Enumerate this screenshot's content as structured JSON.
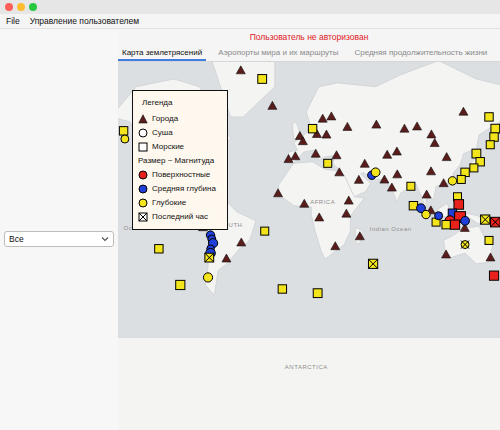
{
  "window": {
    "controls": [
      "close",
      "minimize",
      "zoom"
    ]
  },
  "menu": [
    {
      "label": "File"
    },
    {
      "label": "Управление пользователем"
    }
  ],
  "status": {
    "text": "Пользователь не авторизован",
    "color": "#e0201e"
  },
  "tabs": [
    {
      "label": "Карта землетрясений",
      "selected": true
    },
    {
      "label": "Аэропорты мира и их маршруты",
      "selected": false
    },
    {
      "label": "Средняя продолжительность жизни",
      "selected": false
    }
  ],
  "sidebar": {
    "filter": {
      "value": "Все"
    }
  },
  "legend": {
    "title": "Легенда",
    "items": [
      {
        "kind": "city",
        "label": "Города"
      },
      {
        "kind": "land",
        "label": "Суша"
      },
      {
        "kind": "sea",
        "label": "Морские"
      },
      {
        "kind": "note",
        "label": "Размер ~ Магнитуда"
      },
      {
        "kind": "shallow",
        "label": "Поверхностные",
        "color": "#e8211d"
      },
      {
        "kind": "mid",
        "label": "Средняя глубина",
        "color": "#1f3fd8"
      },
      {
        "kind": "deep",
        "label": "Глубокие",
        "color": "#f3e41c"
      },
      {
        "kind": "recent",
        "label": "Последний час"
      }
    ]
  },
  "map": {
    "labels": [
      {
        "text": "AFRICA",
        "lon": 18,
        "lat": 6
      },
      {
        "text": "SOUTH",
        "lon": -55,
        "lat": -12
      },
      {
        "text": "ANTARCTICA",
        "lon": 5,
        "lat": -77
      },
      {
        "text": "Indian Ocean",
        "lon": 72,
        "lat": -15
      },
      {
        "text": "Ocean",
        "lon": -140,
        "lat": -14
      }
    ],
    "cities": [
      {
        "lon": -47,
        "lat": 74
      },
      {
        "lon": -0.1,
        "lat": 51.5
      },
      {
        "lon": 2.3,
        "lat": 48.9
      },
      {
        "lon": 13.4,
        "lat": 52.5
      },
      {
        "lon": 37.6,
        "lat": 55.8
      },
      {
        "lon": -3.7,
        "lat": 40.4
      },
      {
        "lon": 12.5,
        "lat": 41.9
      },
      {
        "lon": 18,
        "lat": 59.3
      },
      {
        "lon": -21.9,
        "lat": 64.1
      },
      {
        "lon": 29,
        "lat": 41
      },
      {
        "lon": 24.9,
        "lat": 60.2
      },
      {
        "lon": 21,
        "lat": 52.2
      },
      {
        "lon": -9.1,
        "lat": 38.7
      },
      {
        "lon": 31.2,
        "lat": 30
      },
      {
        "lon": 51.4,
        "lat": 35.7
      },
      {
        "lon": 46.7,
        "lat": 24.7
      },
      {
        "lon": 77.2,
        "lat": 28.6
      },
      {
        "lon": 72.9,
        "lat": 19
      },
      {
        "lon": 67,
        "lat": 24.9
      },
      {
        "lon": 60.6,
        "lat": 56.8
      },
      {
        "lon": 82.9,
        "lat": 55
      },
      {
        "lon": 92.9,
        "lat": 56
      },
      {
        "lon": 129.7,
        "lat": 62
      },
      {
        "lon": 104.3,
        "lat": 52.3
      },
      {
        "lon": 76.9,
        "lat": 43.2
      },
      {
        "lon": 69.2,
        "lat": 41.3
      },
      {
        "lon": 116.4,
        "lat": 39.9
      },
      {
        "lon": 104,
        "lat": 30.7
      },
      {
        "lon": 114,
        "lat": 22.3
      },
      {
        "lon": 106.9,
        "lat": 47.9
      },
      {
        "lon": 100.5,
        "lat": 13.7
      },
      {
        "lon": 103.8,
        "lat": 1.3
      },
      {
        "lon": 3.4,
        "lat": 6.5
      },
      {
        "lon": 15.3,
        "lat": -4.3
      },
      {
        "lon": 36.8,
        "lat": -1.3
      },
      {
        "lon": 28,
        "lat": -26.2
      },
      {
        "lon": 38.7,
        "lat": 9
      },
      {
        "lon": -17.4,
        "lat": 14.7
      },
      {
        "lon": 115.9,
        "lat": -31.9
      },
      {
        "lon": 151.2,
        "lat": -33.9
      },
      {
        "lon": 130.8,
        "lat": -12.5
      },
      {
        "lon": -77,
        "lat": -12
      },
      {
        "lon": -58.4,
        "lat": -34.6
      },
      {
        "lon": -46.6,
        "lat": -23.5
      },
      {
        "lon": -74,
        "lat": 4.7
      },
      {
        "lon": 47.5,
        "lat": -18.9
      }
    ],
    "earthquakes": [
      {
        "lon": -140,
        "lat": 54,
        "kind": "sea",
        "depth": "deep",
        "magnitude": 4.6,
        "recent": false
      },
      {
        "lon": -139,
        "lat": 50,
        "kind": "land",
        "depth": "deep",
        "magnitude": 4.5,
        "recent": false
      },
      {
        "lon": -30,
        "lat": 72,
        "kind": "sea",
        "depth": "deep",
        "magnitude": 4.7,
        "recent": false
      },
      {
        "lon": -112,
        "lat": -28,
        "kind": "sea",
        "depth": "deep",
        "magnitude": 4.6,
        "recent": false
      },
      {
        "lon": -95,
        "lat": -50,
        "kind": "sea",
        "depth": "deep",
        "magnitude": 4.8,
        "recent": false
      },
      {
        "lon": -77,
        "lat": 1,
        "kind": "land",
        "depth": "mid",
        "magnitude": 4.5,
        "recent": false
      },
      {
        "lon": -71,
        "lat": -18,
        "kind": "land",
        "depth": "mid",
        "magnitude": 4.6,
        "recent": false
      },
      {
        "lon": -70,
        "lat": -21,
        "kind": "land",
        "depth": "mid",
        "magnitude": 4.5,
        "recent": false
      },
      {
        "lon": -69,
        "lat": -24,
        "kind": "land",
        "depth": "mid",
        "magnitude": 4.8,
        "recent": false
      },
      {
        "lon": -71,
        "lat": -28,
        "kind": "land",
        "depth": "mid",
        "magnitude": 4.4,
        "recent": false
      },
      {
        "lon": -71,
        "lat": -31,
        "kind": "land",
        "depth": "mid",
        "magnitude": 4.9,
        "recent": false
      },
      {
        "lon": -72,
        "lat": -34,
        "kind": "sea",
        "depth": "deep",
        "magnitude": 4.7,
        "recent": true
      },
      {
        "lon": -73,
        "lat": -46,
        "kind": "land",
        "depth": "deep",
        "magnitude": 4.8,
        "recent": false
      },
      {
        "lon": -28,
        "lat": -15,
        "kind": "sea",
        "depth": "deep",
        "magnitude": 4.5,
        "recent": false
      },
      {
        "lon": -14,
        "lat": -52,
        "kind": "sea",
        "depth": "deep",
        "magnitude": 4.6,
        "recent": false
      },
      {
        "lon": 14,
        "lat": -54,
        "kind": "sea",
        "depth": "deep",
        "magnitude": 4.7,
        "recent": false
      },
      {
        "lon": 10,
        "lat": 55,
        "kind": "sea",
        "depth": "deep",
        "magnitude": 4.6,
        "recent": false
      },
      {
        "lon": 22,
        "lat": 36,
        "kind": "sea",
        "depth": "deep",
        "magnitude": 4.5,
        "recent": false
      },
      {
        "lon": 57,
        "lat": 28,
        "kind": "land",
        "depth": "mid",
        "magnitude": 4.6,
        "recent": false
      },
      {
        "lon": 60,
        "lat": 30,
        "kind": "land",
        "depth": "deep",
        "magnitude": 4.7,
        "recent": false
      },
      {
        "lon": 58,
        "lat": -38,
        "kind": "sea",
        "depth": "deep",
        "magnitude": 4.8,
        "recent": true
      },
      {
        "lon": 88,
        "lat": 20,
        "kind": "sea",
        "depth": "deep",
        "magnitude": 4.5,
        "recent": false
      },
      {
        "lon": 90,
        "lat": 5,
        "kind": "sea",
        "depth": "deep",
        "magnitude": 4.6,
        "recent": false
      },
      {
        "lon": 96,
        "lat": 3,
        "kind": "land",
        "depth": "mid",
        "magnitude": 4.7,
        "recent": false
      },
      {
        "lon": 140,
        "lat": 42,
        "kind": "sea",
        "depth": "deep",
        "magnitude": 4.7,
        "recent": false
      },
      {
        "lon": 143,
        "lat": 37,
        "kind": "sea",
        "depth": "deep",
        "magnitude": 4.6,
        "recent": false
      },
      {
        "lon": 138,
        "lat": 33,
        "kind": "sea",
        "depth": "deep",
        "magnitude": 4.5,
        "recent": false
      },
      {
        "lon": 131,
        "lat": 30,
        "kind": "sea",
        "depth": "deep",
        "magnitude": 4.6,
        "recent": false
      },
      {
        "lon": 128,
        "lat": 25,
        "kind": "sea",
        "depth": "deep",
        "magnitude": 4.5,
        "recent": false
      },
      {
        "lon": 121,
        "lat": 24,
        "kind": "land",
        "depth": "deep",
        "magnitude": 4.6,
        "recent": false
      },
      {
        "lon": 150,
        "lat": 60,
        "kind": "sea",
        "depth": "deep",
        "magnitude": 4.6,
        "recent": false
      },
      {
        "lon": 155,
        "lat": 55,
        "kind": "sea",
        "depth": "deep",
        "magnitude": 4.7,
        "recent": false
      },
      {
        "lon": 154,
        "lat": 51,
        "kind": "sea",
        "depth": "deep",
        "magnitude": 4.6,
        "recent": false
      },
      {
        "lon": 151,
        "lat": 47,
        "kind": "sea",
        "depth": "deep",
        "magnitude": 4.5,
        "recent": false
      },
      {
        "lon": 125,
        "lat": 12,
        "kind": "sea",
        "depth": "deep",
        "magnitude": 4.5,
        "recent": false
      },
      {
        "lon": 126,
        "lat": 6,
        "kind": "sea",
        "depth": "shallow",
        "magnitude": 4.9,
        "recent": false
      },
      {
        "lon": 121,
        "lat": -1,
        "kind": "sea",
        "depth": "mid",
        "magnitude": 4.6,
        "recent": false
      },
      {
        "lon": 119,
        "lat": -7,
        "kind": "land",
        "depth": "shallow",
        "magnitude": 5.0,
        "recent": false
      },
      {
        "lon": 127,
        "lat": -4,
        "kind": "sea",
        "depth": "shallow",
        "magnitude": 5.2,
        "recent": false
      },
      {
        "lon": 116,
        "lat": -10,
        "kind": "sea",
        "depth": "deep",
        "magnitude": 4.6,
        "recent": false
      },
      {
        "lon": 108,
        "lat": -8,
        "kind": "sea",
        "depth": "deep",
        "magnitude": 4.5,
        "recent": false
      },
      {
        "lon": 131,
        "lat": -7,
        "kind": "land",
        "depth": "mid",
        "magnitude": 4.7,
        "recent": false
      },
      {
        "lon": 123,
        "lat": -10,
        "kind": "sea",
        "depth": "shallow",
        "magnitude": 4.8,
        "recent": false
      },
      {
        "lon": 110,
        "lat": -3,
        "kind": "land",
        "depth": "mid",
        "magnitude": 4.5,
        "recent": false
      },
      {
        "lon": 100,
        "lat": -2,
        "kind": "land",
        "depth": "deep",
        "magnitude": 4.6,
        "recent": false
      },
      {
        "lon": 147,
        "lat": -6,
        "kind": "sea",
        "depth": "deep",
        "magnitude": 4.8,
        "recent": true
      },
      {
        "lon": 155,
        "lat": -8,
        "kind": "sea",
        "depth": "shallow",
        "magnitude": 4.9,
        "recent": true
      },
      {
        "lon": 131,
        "lat": -25,
        "kind": "land",
        "depth": "deep",
        "magnitude": 4.5,
        "recent": true
      },
      {
        "lon": 150,
        "lat": -22,
        "kind": "sea",
        "depth": "deep",
        "magnitude": 4.5,
        "recent": false
      },
      {
        "lon": 154,
        "lat": -45,
        "kind": "sea",
        "depth": "shallow",
        "magnitude": 4.8,
        "recent": false
      }
    ]
  }
}
